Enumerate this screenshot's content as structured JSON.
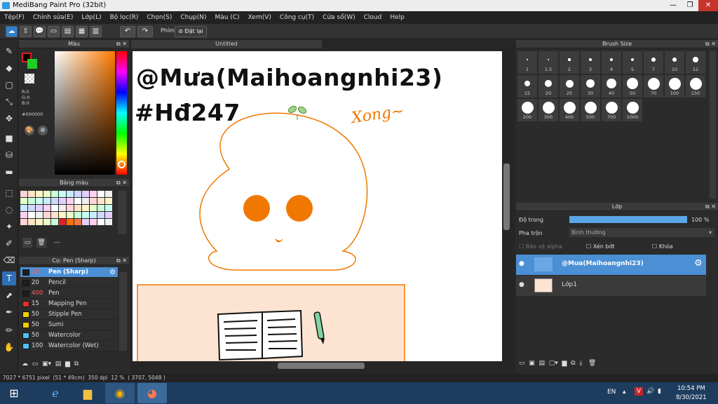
{
  "window": {
    "title": "MediBang Paint Pro (32bit)",
    "minimize": "—",
    "restore": "❐",
    "close": "✕"
  },
  "menu": [
    "Tệp(F)",
    "Chỉnh sửa(E)",
    "Lớp(L)",
    "Bộ lọc(R)",
    "Chọn(S)",
    "Chụp(N)",
    "Màu (C)",
    "Xem(V)",
    "Công cụ(T)",
    "Cửa sổ(W)",
    "Cloud",
    "Help"
  ],
  "toolbar": {
    "snap_label": "Phím",
    "snap_button": "Đặt lại"
  },
  "color_panel": {
    "title": "Màu",
    "r": "R:0",
    "g": "G:0",
    "b": "B:0",
    "hex": "#000000"
  },
  "palette_panel": {
    "title": "Bảng màu",
    "extra": "---"
  },
  "brush_panel": {
    "title": "Cọ: Pen (Sharp)",
    "items": [
      {
        "size": "20",
        "name": "Pen (Sharp)",
        "color": "#1e1e1e"
      },
      {
        "size": "20",
        "name": "Pencil",
        "color": "#1e1e1e"
      },
      {
        "size": "400",
        "name": "Pen",
        "color": "#1e1e1e"
      },
      {
        "size": "15",
        "name": "Mapping Pen",
        "color": "#e03030"
      },
      {
        "size": "50",
        "name": "Stipple Pen",
        "color": "#f0d000"
      },
      {
        "size": "50",
        "name": "Sumi",
        "color": "#f0d000"
      },
      {
        "size": "50",
        "name": "Watercolor",
        "color": "#4fc3f7"
      },
      {
        "size": "100",
        "name": "Watercolor (Wet)",
        "color": "#4fc3f7"
      }
    ]
  },
  "canvas": {
    "tab": "Untitled",
    "text_line1": "@Mưa(Maihoangnhi23)",
    "text_line2": "#Hđ247",
    "text_small": "Xong~"
  },
  "brush_size_panel": {
    "title": "Brush Size",
    "sizes": [
      "1",
      "1.5",
      "2",
      "3",
      "4",
      "5",
      "7",
      "10",
      "12",
      "15",
      "20",
      "25",
      "30",
      "40",
      "50",
      "70",
      "100",
      "150",
      "200",
      "300",
      "400",
      "500",
      "700",
      "1000"
    ]
  },
  "layer_panel": {
    "title": "Lớp",
    "opacity_label": "Độ trong",
    "opacity_value": "100 %",
    "opacity_fraction": 1.0,
    "blend_label": "Pha trộn",
    "blend_value": "Bình thường",
    "protect_alpha": "Bảo vệ alpha",
    "clipping": "Xén bớt",
    "lock": "Khóa",
    "layers": [
      {
        "name": "@Mưa(Maihoangnhi23)",
        "selected": true
      },
      {
        "name": "Lớp1",
        "selected": false
      }
    ]
  },
  "status": {
    "size": "7027 * 6751 pixel",
    "cm": "(51 * 49cm)",
    "dpi": "350 dpi",
    "zoom": "12 %",
    "coords": "( 3707, 5048 )"
  },
  "taskbar": {
    "lang": "EN",
    "time": "10:54 PM",
    "date": "8/30/2021"
  },
  "colors": {
    "accent": "#4b8fd4",
    "orange": "#f07800",
    "blob_fill": "#fde4d2"
  }
}
